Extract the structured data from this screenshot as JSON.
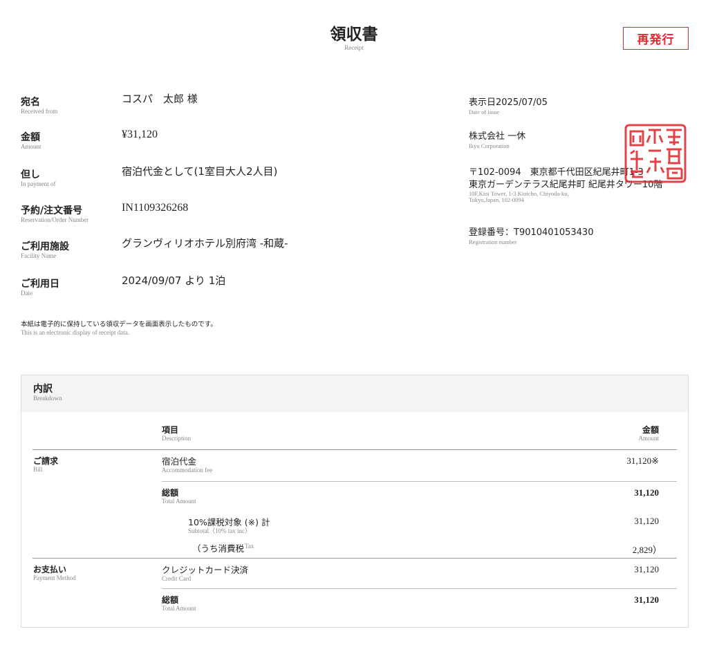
{
  "header": {
    "title": "領収書",
    "title_en": "Receipt",
    "reissue_badge": "再発行"
  },
  "info": {
    "recipient": {
      "label": "宛名",
      "label_en": "Received from",
      "value": "コスパ　太郎 様"
    },
    "amount": {
      "label": "金額",
      "label_en": "Amount",
      "value": "¥31,120"
    },
    "purpose": {
      "label": "但し",
      "label_en": "In payment of",
      "value": "宿泊代金として(1室目大人2人目)"
    },
    "order_no": {
      "label": "予約/注文番号",
      "label_en": "Reservation/Order Number",
      "value": "IN1109326268"
    },
    "facility": {
      "label": "ご利用施設",
      "label_en": "Facility Name",
      "value": "グランヴィリオホテル別府湾 -和蔵-"
    },
    "date": {
      "label": "ご利用日",
      "label_en": "Date",
      "value": "2024/09/07 より 1泊"
    }
  },
  "issuer": {
    "issue_date": "表示日2025/07/05",
    "issue_date_en": "Date of issue",
    "company": "株式会社 一休",
    "company_en": "Ikyu Corporation",
    "address_line1": "〒102-0094　東京都千代田区紀尾井町1-3",
    "address_line2": "東京ガーデンテラス紀尾井町 紀尾井タワー10階",
    "address_en_line1": "10F,Kioi Tower, 1-3 Kioicho, Chiyoda-ku,",
    "address_en_line2": "Tokyo,Japan, 102-0094",
    "registration": "登録番号：T9010401053430",
    "registration_en": "Registration number",
    "seal_text": "株式会社一休之印"
  },
  "note": {
    "text": "本紙は電子的に保持している領収データを画面表示したものです。",
    "text_en": "This is an electronic display of receipt data."
  },
  "breakdown": {
    "title": "内訳",
    "title_en": "Breakdown",
    "col_item": "項目",
    "col_item_en": "Description",
    "col_amount": "金額",
    "col_amount_en": "Amount",
    "bill_label": "ご請求",
    "bill_label_en": "Bill",
    "accommodation": "宿泊代金",
    "accommodation_en": "Accommodation fee",
    "accommodation_amount": "31,120※",
    "total_label": "総額",
    "total_label_en": "Total Amount",
    "total_amount": "31,120",
    "subtotal_label": "10%課税対象 (※) 計",
    "subtotal_label_en": "Subtotal（10% tax inc）",
    "subtotal_amount": "31,120",
    "tax_label": "（うち消費税",
    "tax_label_en": "Tax",
    "tax_amount": "2,829）",
    "payment_label": "お支払い",
    "payment_label_en": "Payment Method",
    "payment_method": "クレジットカード決済",
    "payment_method_en": "Credit Card",
    "payment_amount": "31,120",
    "payment_total_label": "総額",
    "payment_total_label_en": "Total Amount",
    "payment_total_amount": "31,120"
  },
  "colors": {
    "accent_red": "#e0282e",
    "panel_bg": "#f4f4f4"
  }
}
